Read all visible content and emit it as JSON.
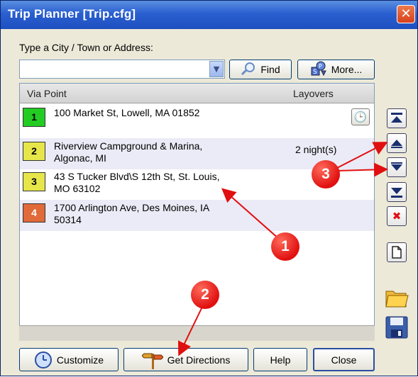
{
  "window": {
    "title": "Trip Planner [Trip.cfg]",
    "close_glyph": "✕"
  },
  "search": {
    "label": "Type a City / Town or Address:",
    "value": "",
    "find_label": "Find",
    "more_label": "More..."
  },
  "list": {
    "headers": {
      "via": "Via Point",
      "layovers": "Layovers"
    },
    "rows": [
      {
        "num": "1",
        "color": "#22cc22",
        "line1": "100 Market St, Lowell, MA 01852",
        "line2": "",
        "layover": ""
      },
      {
        "num": "2",
        "color": "#e6e64a",
        "line1": "Riverview Campground & Marina,",
        "line2": "Algonac, MI",
        "layover": "2 night(s)"
      },
      {
        "num": "3",
        "color": "#e6e64a",
        "line1": "43 S Tucker Blvd\\S 12th St, St. Louis,",
        "line2": "MO 63102",
        "layover": ""
      },
      {
        "num": "4",
        "color": "#e06a3a",
        "line1": "1700 Arlington Ave, Des Moines, IA",
        "line2": "50314",
        "layover": ""
      }
    ]
  },
  "buttons": {
    "customize": "Customize",
    "get_directions": "Get Directions",
    "help": "Help",
    "close": "Close"
  },
  "callouts": {
    "one": "1",
    "two": "2",
    "three": "3"
  },
  "colors": {
    "title_bar": "#2a5fd0",
    "window_bg": "#ece9d8",
    "callout_red": "#e01010",
    "alt_row": "#ebebf7"
  },
  "icons": [
    "clock-icon",
    "magnifier-icon",
    "poi-icon",
    "move-top-icon",
    "move-up-icon",
    "move-down-icon",
    "move-bottom-icon",
    "delete-icon",
    "new-document-icon",
    "open-folder-icon",
    "save-disk-icon",
    "customize-clock-icon",
    "directions-signpost-icon"
  ]
}
